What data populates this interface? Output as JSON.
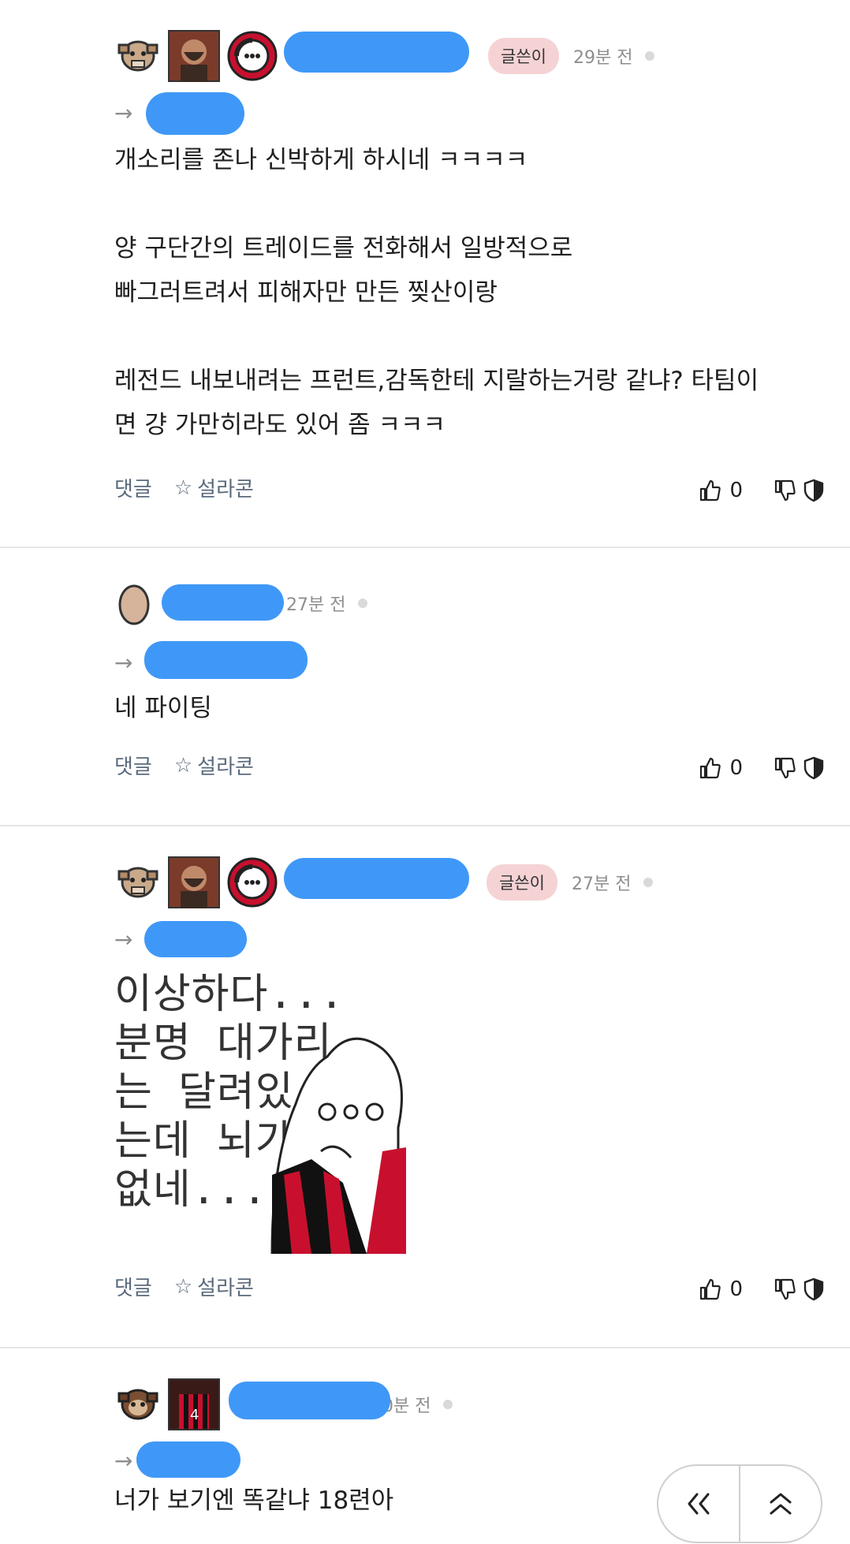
{
  "comments": [
    {
      "badge": "글쓴이",
      "time": "29분 전",
      "body": "개소리를 존나 신박하게 하시네 ㅋㅋㅋㅋ\n\n양 구단간의 트레이드를 전화해서 일방적으로\n빠그러트려서 피해자만 만든 찢산이랑\n\n레전드 내보내려는 프런트,감독한테 지랄하는거랑 같냐? 타팀이\n면 걍 가만히라도 있어 좀 ㅋㅋㅋ",
      "reply_label": "댓글",
      "sulla_label": "설라콘",
      "likes": "0"
    },
    {
      "time": "27분 전",
      "body": "네 파이팅",
      "reply_label": "댓글",
      "sulla_label": "설라콘",
      "likes": "0"
    },
    {
      "badge": "글쓴이",
      "time": "27분 전",
      "meme_text": "이상하다...\n분명 대가리\n는 달려있\n는데 뇌가\n없네...",
      "reply_label": "댓글",
      "sulla_label": "설라콘",
      "likes": "0"
    },
    {
      "time": "30분 전",
      "body": "너가 보기엔 똑같냐 18련아"
    }
  ],
  "colors": {
    "blur": "#3f98f7",
    "badge_bg": "#f5d3d5",
    "action_text": "#5a6a7c"
  },
  "icons": {
    "reply_arrow": "arrow-right-icon",
    "star": "star-icon",
    "like": "thumbs-up-icon",
    "dislike": "thumbs-down-icon",
    "shield": "shield-icon",
    "scroll_top": "double-chevron-up-icon",
    "back": "double-chevron-left-icon"
  }
}
